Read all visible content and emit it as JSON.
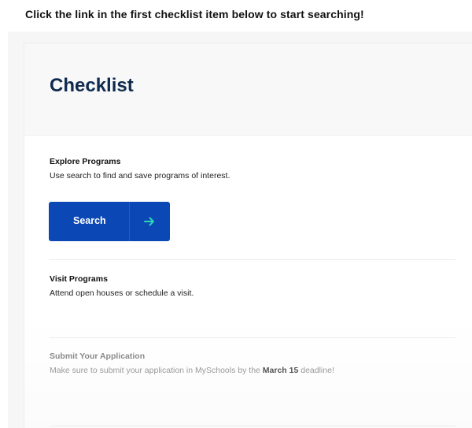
{
  "instruction": "Click the link in the first checklist item below to start searching!",
  "checklist": {
    "title": "Checklist",
    "items": [
      {
        "title": "Explore Programs",
        "description": "Use search to find and save programs of interest.",
        "button_label": "Search",
        "button_icon": "arrow-right-icon"
      },
      {
        "title": "Visit Programs",
        "description": "Attend open houses or schedule a visit."
      },
      {
        "title": "Submit Your Application",
        "description_before": "Make sure to submit your application in MySchools by the ",
        "description_bold": "March 15",
        "description_after": " deadline!"
      }
    ]
  },
  "colors": {
    "button": "#0b47b5",
    "title": "#0f2a4f",
    "arrow": "#2ed3b4"
  }
}
